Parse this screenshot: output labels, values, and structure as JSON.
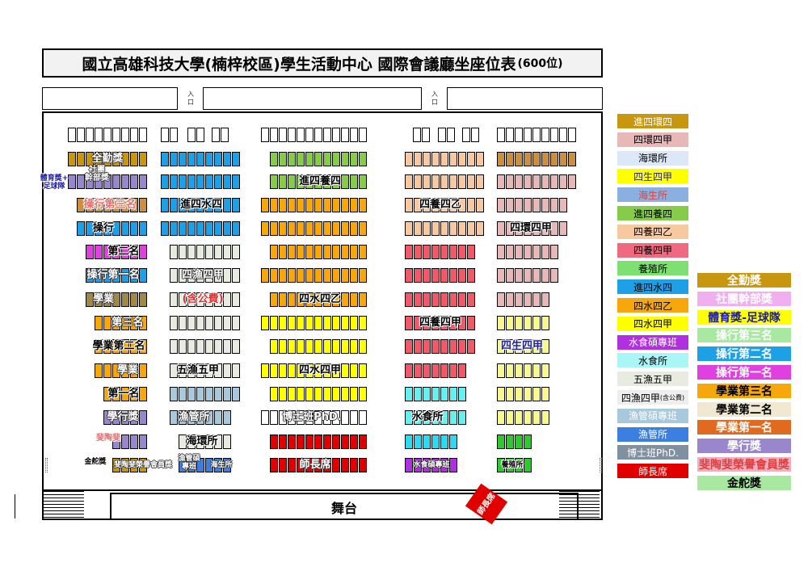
{
  "title": "國立高雄科技大學(楠梓校區)學生活動中心  國際會議廳坐座位表",
  "capacity": "(600位)",
  "entrance_label": "入\n口",
  "stage_label": "舞台",
  "stage_tag": "師長席",
  "colors": {
    "gold": "#c8960f",
    "blue": "#1ea0e6",
    "green": "#86cc4a",
    "peach": "#f8c8a0",
    "sienna": "#c89040",
    "orange": "#f5a70c",
    "pink": "#e8b8b8",
    "magenta": "#e040e0",
    "lightgray": "#e8ece0",
    "yellow": "#ffff00",
    "rose": "#ef5a6a",
    "lightyellow": "#f8f890",
    "brown": "#a08848",
    "cyan": "#66f0f0",
    "dodger": "#3d7fe0",
    "steel": "#a8c8dc",
    "red": "#e00000",
    "aqua": "#30d8f0",
    "purple": "#b030e0",
    "limegreen": "#30c830",
    "violet": "#9a86cc",
    "lightgreen": "#a8e8a0",
    "white": "#ffffff"
  },
  "row_labels": [
    {
      "text": "全勤獎",
      "color": "#ffffff"
    },
    {
      "text": "社團\n幹部獎",
      "color": "#ffffff"
    },
    {
      "text": "體育獎+\n足球隊",
      "color": "#1e1ea0"
    },
    {
      "text": "進四養四",
      "color": "#000000"
    },
    {
      "text": "操行第三名",
      "color": "#e07070"
    },
    {
      "text": "進四水四",
      "color": "#000000"
    },
    {
      "text": "四養四乙",
      "color": "#000000"
    },
    {
      "text": "操行",
      "color": "#000000"
    },
    {
      "text": "四環四甲",
      "color": "#000000"
    },
    {
      "text": "第二名",
      "color": "#000000"
    },
    {
      "text": "操行第一名",
      "color": "#ffffff"
    },
    {
      "text": "四漁四甲",
      "color": "#ffffff"
    },
    {
      "text": "學業",
      "color": "#ffffff"
    },
    {
      "text": "(含公費)",
      "color": "#e03030"
    },
    {
      "text": "四水四乙",
      "color": "#000000"
    },
    {
      "text": "第三名",
      "color": "#ffffff"
    },
    {
      "text": "四養四甲",
      "color": "#000000"
    },
    {
      "text": "學業第二名",
      "color": "#000000"
    },
    {
      "text": "四生四甲",
      "color": "#1e1ea0"
    },
    {
      "text": "學業",
      "color": "#ffffff"
    },
    {
      "text": "五漁五甲",
      "color": "#000000"
    },
    {
      "text": "四水四甲",
      "color": "#000000"
    },
    {
      "text": "第一名",
      "color": "#000000"
    },
    {
      "text": "學行獎",
      "color": "#ffffff"
    },
    {
      "text": "漁管所",
      "color": "#ffffff"
    },
    {
      "text": "博士班PhD.",
      "color": "#ffffff"
    },
    {
      "text": "水食所",
      "color": "#000000"
    },
    {
      "text": "斐陶斐",
      "color": "#e07070"
    },
    {
      "text": "海環所",
      "color": "#000000"
    },
    {
      "text": "金舵獎",
      "color": "#000000"
    },
    {
      "text": "斐陶斐榮譽會員獎",
      "color": "#ffffff"
    },
    {
      "text": "漁管碩\n專班",
      "color": "#ffffff"
    },
    {
      "text": "海生所",
      "color": "#ffffff"
    },
    {
      "text": "師長席",
      "color": "#ffffff"
    },
    {
      "text": "水食碩專班",
      "color": "#ffffff"
    },
    {
      "text": "養殖所",
      "color": "#000000"
    }
  ],
  "legend_left": [
    {
      "label": "進四環四",
      "bg": "#c8960f",
      "fg": "#ffffff"
    },
    {
      "label": "四環四甲",
      "bg": "#e8b8b8",
      "fg": "#000000"
    },
    {
      "label": "海環所",
      "bg": "#dce8f8",
      "fg": "#000000"
    },
    {
      "label": "四生四甲",
      "bg": "#ffff00",
      "fg": "#1e1ea0"
    },
    {
      "label": "海生所",
      "bg": "#8ab0e0",
      "fg": "#e04040"
    },
    {
      "label": "進四養四",
      "bg": "#86cc4a",
      "fg": "#000000"
    },
    {
      "label": "四養四乙",
      "bg": "#f8c8a0",
      "fg": "#000000"
    },
    {
      "label": "四養四甲",
      "bg": "#ef6a80",
      "fg": "#000000"
    },
    {
      "label": "養殖所",
      "bg": "#7ee070",
      "fg": "#000000"
    },
    {
      "label": "進四水四",
      "bg": "#1ea0e6",
      "fg": "#000000"
    },
    {
      "label": "四水四乙",
      "bg": "#f5a70c",
      "fg": "#000000"
    },
    {
      "label": "四水四甲",
      "bg": "#ffff00",
      "fg": "#000000"
    },
    {
      "label": "水食碩專班",
      "bg": "#b030e0",
      "fg": "#ffffff"
    },
    {
      "label": "水食所",
      "bg": "#aaf6f6",
      "fg": "#000000"
    },
    {
      "label": "五漁五甲",
      "bg": "#e8ece0",
      "fg": "#000000"
    },
    {
      "label": "四漁四甲",
      "bg": "#eeeeee",
      "fg": "#000000"
    },
    {
      "label": "(含公費)",
      "bg": "",
      "fg": "#000000"
    },
    {
      "label": "漁管碩專班",
      "bg": "#a8c8dc",
      "fg": "#ffffff"
    },
    {
      "label": "漁管所",
      "bg": "#3d7fe0",
      "fg": "#ffffff"
    },
    {
      "label": "博士班PhD.",
      "bg": "#8090a0",
      "fg": "#ffffff"
    },
    {
      "label": "師長席",
      "bg": "#e00000",
      "fg": "#ffffff"
    }
  ],
  "legend_right": [
    {
      "label": "全勤獎",
      "bg": "#c8960f",
      "fg": "#ffffff"
    },
    {
      "label": "社團幹部獎",
      "bg": "#f0b0f0",
      "fg": "#ffffff"
    },
    {
      "label": "體育獎-足球隊",
      "bg": "#ffff00",
      "fg": "#1e1ea0"
    },
    {
      "label": "操行第三名",
      "bg": "#a8e8a0",
      "fg": "#ffffff"
    },
    {
      "label": "操行第二名",
      "bg": "#1ea0e6",
      "fg": "#ffffff"
    },
    {
      "label": "操行第一名",
      "bg": "#e040e0",
      "fg": "#ffffff"
    },
    {
      "label": "學業第三名",
      "bg": "#f5a70c",
      "fg": "#000000"
    },
    {
      "label": "學業第二名",
      "bg": "#f0e8d0",
      "fg": "#000000"
    },
    {
      "label": "學業第一名",
      "bg": "#e06a20",
      "fg": "#ffffff"
    },
    {
      "label": "學行獎",
      "bg": "#9a86cc",
      "fg": "#ffffff"
    },
    {
      "label": "斐陶斐榮譽會員獎",
      "bg": "#f0b0c0",
      "fg": "#e04040"
    },
    {
      "label": "金舵獎",
      "bg": "#a8e8a0",
      "fg": "#000000"
    }
  ]
}
